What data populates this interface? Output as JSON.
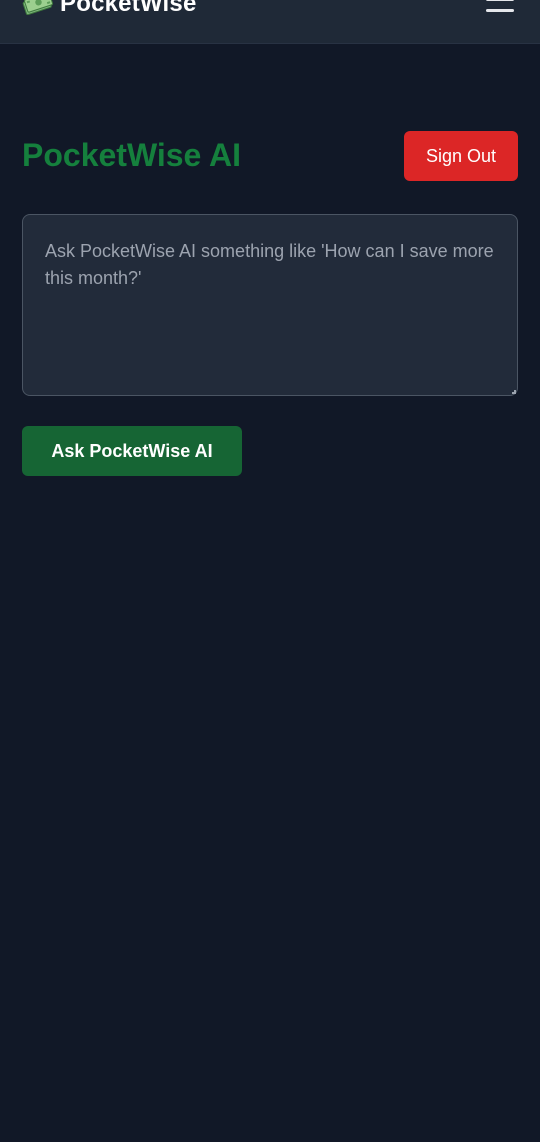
{
  "navbar": {
    "brand_name": "PocketWise",
    "brand_icon": "money-bills-icon",
    "menu_icon": "hamburger-menu-icon"
  },
  "main": {
    "title": "PocketWise AI",
    "sign_out_label": "Sign Out",
    "prompt_placeholder": "Ask PocketWise AI something like 'How can I save more this month?'",
    "prompt_value": "",
    "ask_button_label": "Ask PocketWise AI"
  },
  "colors": {
    "background": "#111827",
    "navbar": "#1f2937",
    "title_green": "#15803d",
    "sign_out_red": "#dc2626",
    "ask_button_green": "#166534",
    "input_background": "#222b3a"
  }
}
